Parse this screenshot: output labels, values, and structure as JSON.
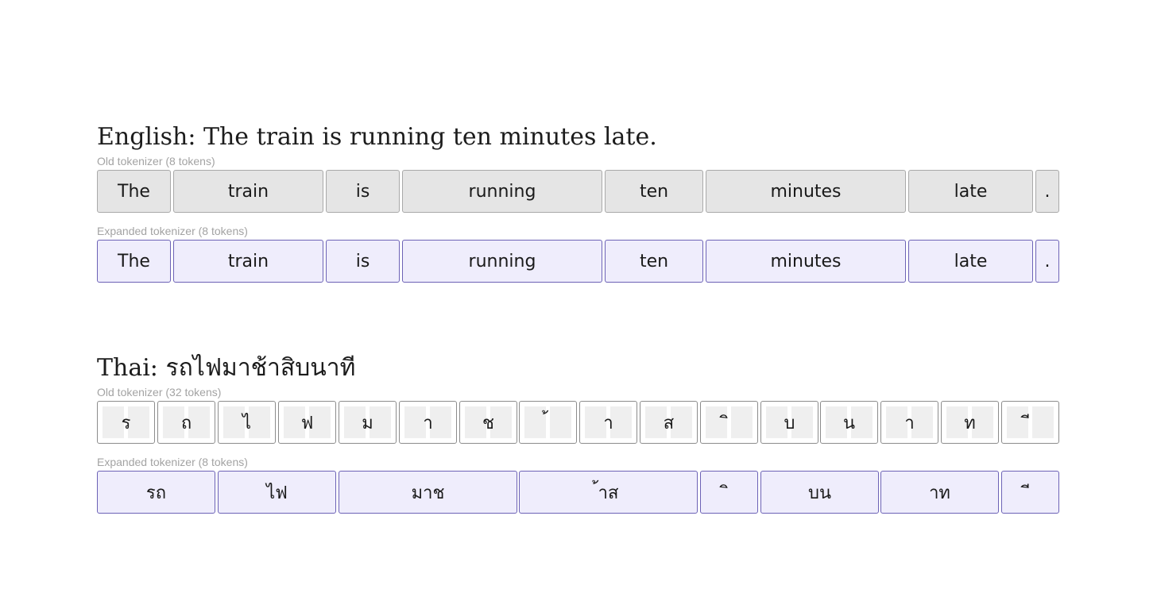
{
  "sections": [
    {
      "title": "English: The train is running ten minutes late.",
      "old_label": "Old tokenizer (8 tokens)",
      "old_tokens": [
        "The",
        "train",
        "is",
        "running",
        "ten",
        "minutes",
        "late",
        "."
      ],
      "expanded_label": "Expanded tokenizer (8 tokens)",
      "expanded_tokens": [
        "The",
        "train",
        "is",
        "running",
        "ten",
        "minutes",
        "late",
        "."
      ]
    },
    {
      "title": "Thai: รถไฟมาช้าสิบนาที",
      "old_label": "Old tokenizer (32 tokens)",
      "old_tokens": [
        "ร",
        "ถ",
        "ไ",
        "ฟ",
        "ม",
        "า",
        "ช",
        "้",
        "า",
        "ส",
        "ิ",
        "บ",
        "น",
        "า",
        "ท",
        "ี"
      ],
      "expanded_label": "Expanded tokenizer (8 tokens)",
      "expanded_tokens": [
        "รถ",
        "ไฟ",
        "มาช",
        "้าส",
        "ิ",
        "บน",
        "าท",
        "ี"
      ]
    }
  ],
  "colors": {
    "old_bg": "#e5e5e5",
    "old_border": "#a9a9a9",
    "expanded_bg": "#efedfc",
    "expanded_border": "#6c62b6"
  }
}
